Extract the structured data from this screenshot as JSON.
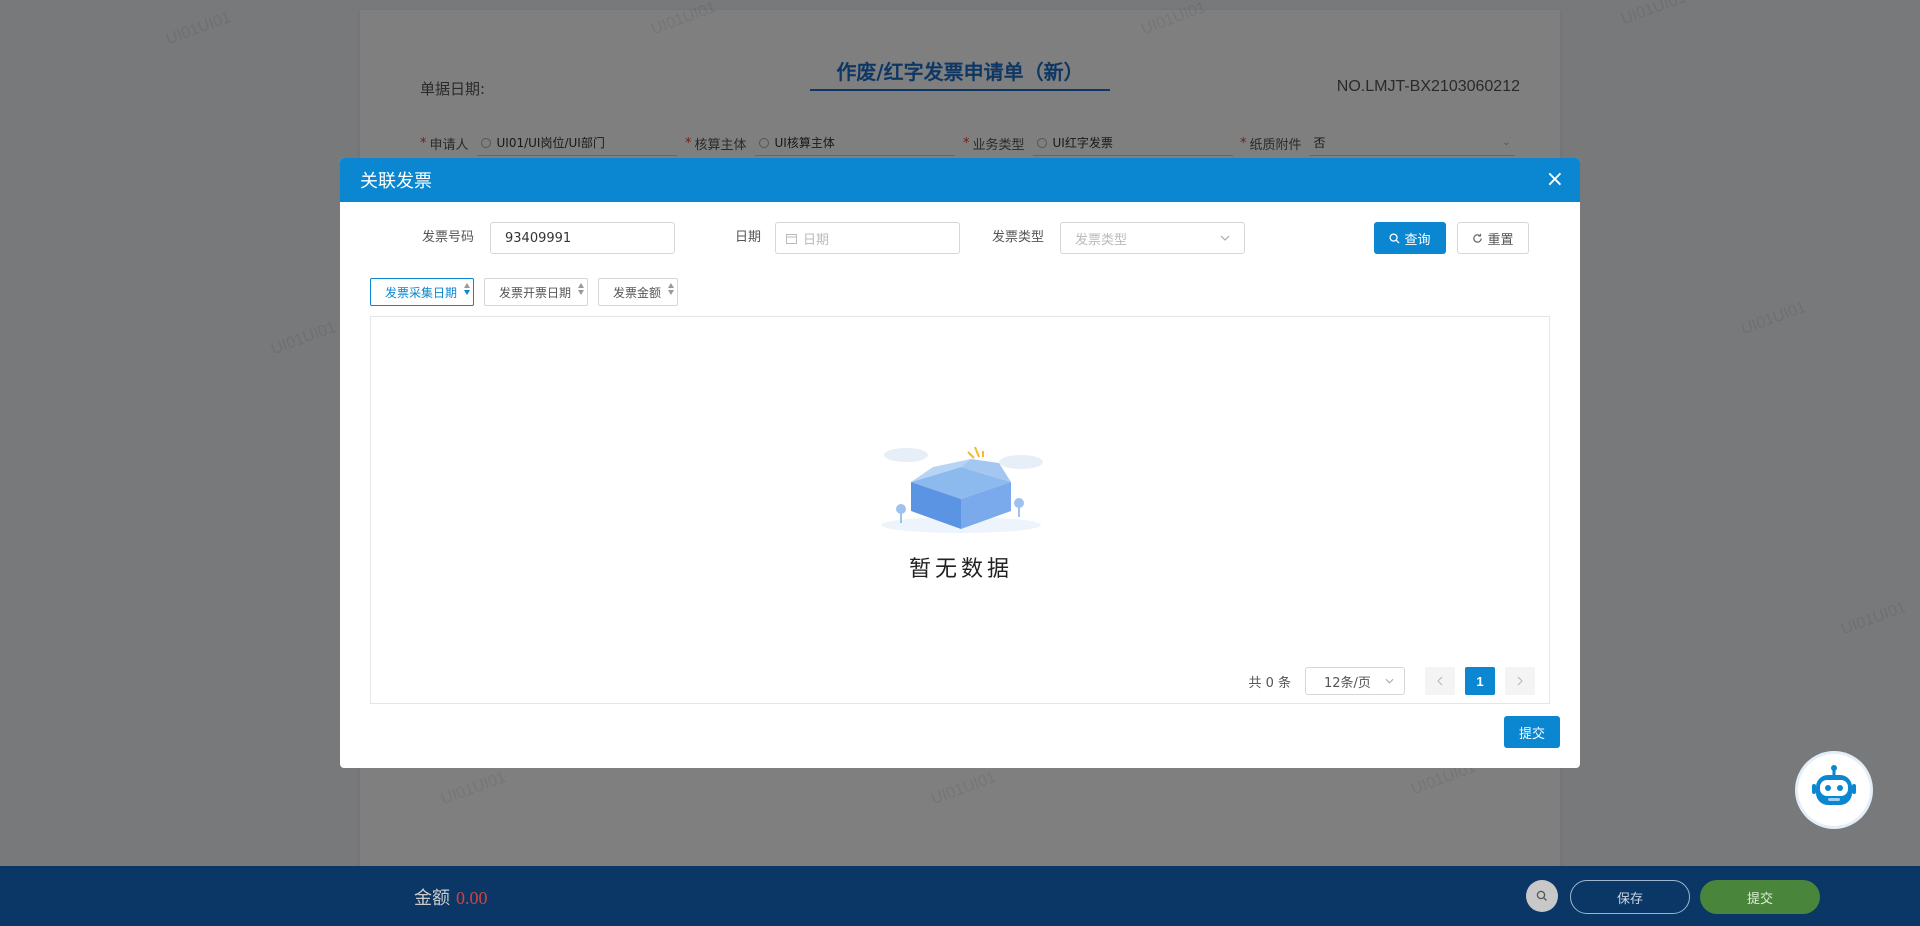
{
  "form": {
    "title": "作废/红字发票申请单（新）",
    "date_label": "单据日期:",
    "doc_no": "NO.LMJT-BX2103060212",
    "fields": [
      {
        "label": "申请人",
        "value": "UI01/UI岗位/UI部门"
      },
      {
        "label": "核算主体",
        "value": "UI核算主体"
      },
      {
        "label": "业务类型",
        "value": "UI红字发票"
      },
      {
        "label": "纸质附件",
        "value": "否"
      }
    ]
  },
  "watermark": "UI01UI01",
  "dialog": {
    "title": "关联发票",
    "close": "×",
    "search": {
      "invoice_no_label": "发票号码",
      "invoice_no_value": "93409991",
      "date_label": "日期",
      "date_placeholder": "日期",
      "type_label": "发票类型",
      "type_placeholder": "发票类型",
      "query_label": "查询",
      "reset_label": "重置"
    },
    "sorts": [
      "发票采集日期",
      "发票开票日期",
      "发票金额"
    ],
    "empty_text": "暂无数据",
    "pager": {
      "total": "共 0 条",
      "page_size": "12条/页",
      "current_page": "1"
    },
    "submit_label": "提交"
  },
  "bottom_bar": {
    "amount_label": "金额",
    "amount_value": "0.00",
    "save_label": "保存",
    "submit_label": "提交"
  },
  "colors": {
    "primary": "#0a87d0",
    "title_blue": "#1c6fc9",
    "bottom_bar": "#0a3766",
    "submit_green": "#49853a",
    "amount_red": "#d54040"
  }
}
